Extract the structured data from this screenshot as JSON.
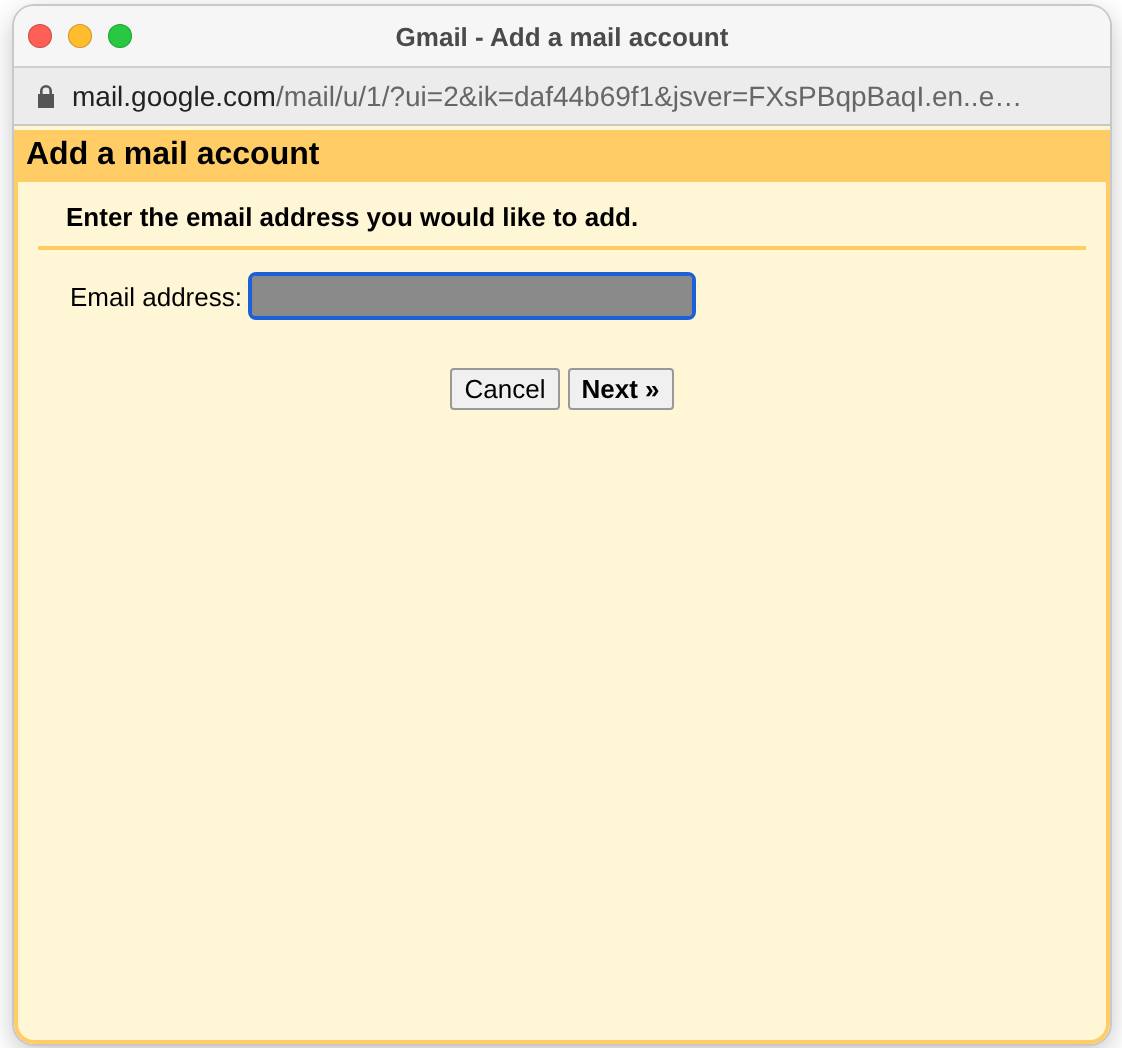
{
  "window": {
    "title": "Gmail - Add a mail account",
    "url_host": "mail.google.com",
    "url_path": "/mail/u/1/?ui=2&ik=daf44b69f1&jsver=FXsPBqpBaqI.en..e…"
  },
  "dialog": {
    "title": "Add a mail account",
    "instruction": "Enter the email address you would like to add.",
    "email_label": "Email address:",
    "email_focused": true,
    "buttons": [
      {
        "label": "Cancel",
        "kind": "secondary"
      },
      {
        "label": "Next »",
        "kind": "primary"
      }
    ]
  }
}
